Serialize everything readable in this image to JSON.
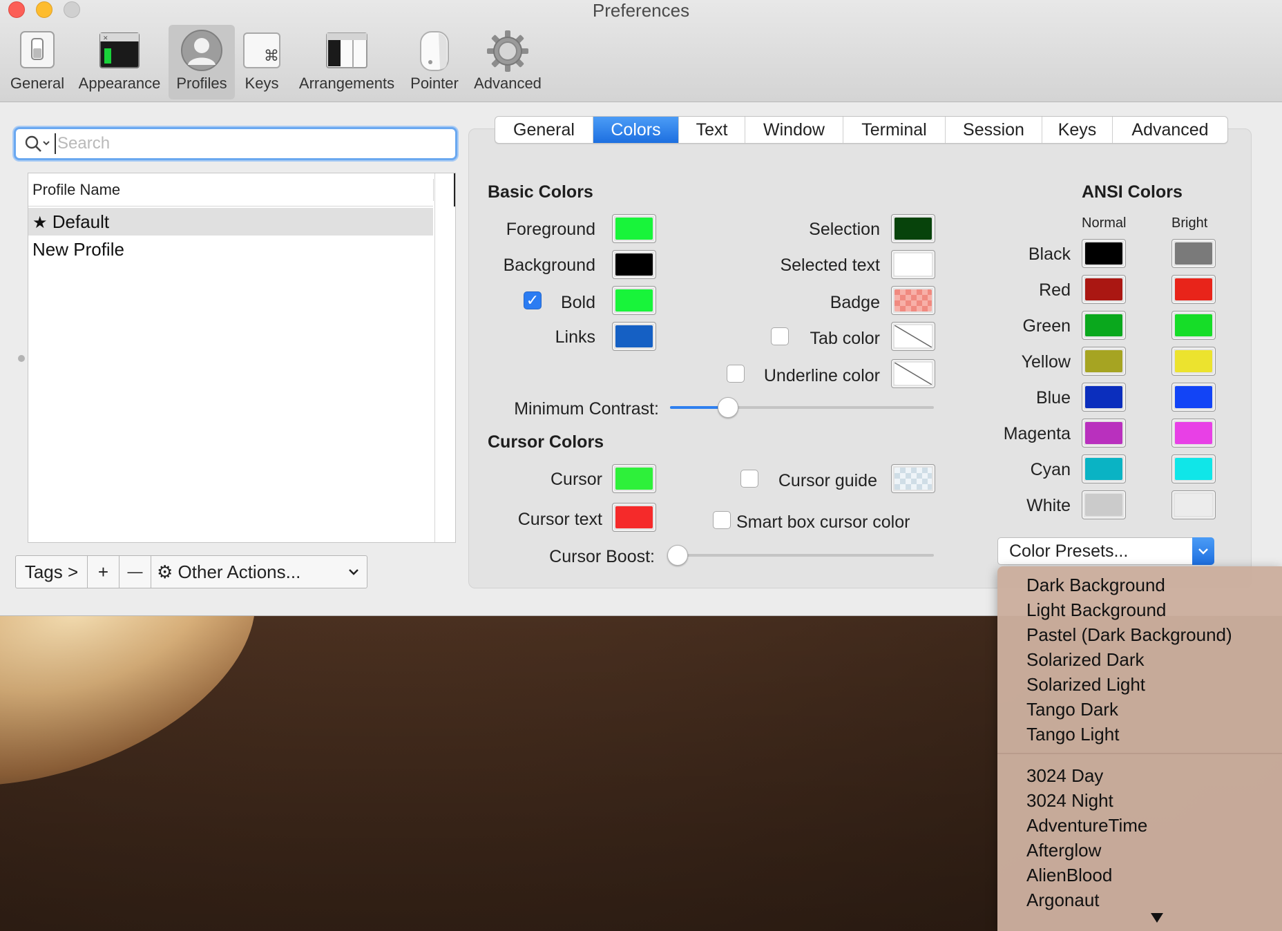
{
  "window": {
    "title": "Preferences"
  },
  "toolbar": {
    "items": [
      {
        "label": "General",
        "icon": "general-switch-icon"
      },
      {
        "label": "Appearance",
        "icon": "terminal-window-icon"
      },
      {
        "label": "Profiles",
        "icon": "user-silhouette-icon",
        "selected": true
      },
      {
        "label": "Keys",
        "icon": "command-key-icon"
      },
      {
        "label": "Arrangements",
        "icon": "window-arrangement-icon"
      },
      {
        "label": "Pointer",
        "icon": "mouse-icon"
      },
      {
        "label": "Advanced",
        "icon": "gear-icon"
      }
    ]
  },
  "search": {
    "placeholder": "Search",
    "value": ""
  },
  "profiles": {
    "header": "Profile Name",
    "rows": [
      {
        "label": "Default",
        "default": true,
        "selected": true
      },
      {
        "label": "New Profile"
      }
    ]
  },
  "bottom_bar": {
    "tags": "Tags >",
    "add": "+",
    "remove": "—",
    "other_actions": "Other Actions..."
  },
  "tabs": {
    "items": [
      "General",
      "Colors",
      "Text",
      "Window",
      "Terminal",
      "Session",
      "Keys",
      "Advanced"
    ],
    "active": "Colors"
  },
  "basic_colors": {
    "title": "Basic Colors",
    "foreground": {
      "label": "Foreground",
      "color": "#18f43a"
    },
    "background": {
      "label": "Background",
      "color": "#000000"
    },
    "bold": {
      "label": "Bold",
      "color": "#18f43a",
      "checked": true
    },
    "links": {
      "label": "Links",
      "color": "#1560c4"
    },
    "selection": {
      "label": "Selection",
      "color": "#07430b"
    },
    "selected_text": {
      "label": "Selected text",
      "color": "#ffffff"
    },
    "badge": {
      "label": "Badge",
      "color": "#f08a80"
    },
    "tab_color": {
      "label": "Tab color",
      "checked": false
    },
    "underline_color": {
      "label": "Underline color",
      "checked": false
    },
    "minimum_contrast": {
      "label": "Minimum Contrast:",
      "value": 0.22
    }
  },
  "cursor_colors": {
    "title": "Cursor Colors",
    "cursor": {
      "label": "Cursor",
      "color": "#2ef03a"
    },
    "cursor_text": {
      "label": "Cursor text",
      "color": "#f52a2a"
    },
    "cursor_guide": {
      "label": "Cursor guide",
      "checked": false,
      "color": "#e8f1f6"
    },
    "smart_box": {
      "label": "Smart box cursor color",
      "checked": false
    },
    "cursor_boost": {
      "label": "Cursor Boost:",
      "value": 0.0
    }
  },
  "ansi": {
    "title": "ANSI Colors",
    "normal_header": "Normal",
    "bright_header": "Bright",
    "rows": [
      {
        "label": "Black",
        "normal": "#000000",
        "bright": "#7a7a7a"
      },
      {
        "label": "Red",
        "normal": "#aa1712",
        "bright": "#e8241a"
      },
      {
        "label": "Green",
        "normal": "#0aa81d",
        "bright": "#16dd28"
      },
      {
        "label": "Yellow",
        "normal": "#a6a422",
        "bright": "#ece32e"
      },
      {
        "label": "Blue",
        "normal": "#0b2ebd",
        "bright": "#1244f6"
      },
      {
        "label": "Magenta",
        "normal": "#b930be",
        "bright": "#e840e6"
      },
      {
        "label": "Cyan",
        "normal": "#0ab3c4",
        "bright": "#10e6e8"
      },
      {
        "label": "White",
        "normal": "#cbcbcb",
        "bright": "#ececec"
      }
    ]
  },
  "presets": {
    "button_label": "Color Presets...",
    "items_group1": [
      "Dark Background",
      "Light Background",
      "Pastel (Dark Background)",
      "Solarized Dark",
      "Solarized Light",
      "Tango Dark",
      "Tango Light"
    ],
    "items_group2": [
      "3024 Day",
      "3024 Night",
      "AdventureTime",
      "Afterglow",
      "AlienBlood",
      "Argonaut"
    ]
  }
}
